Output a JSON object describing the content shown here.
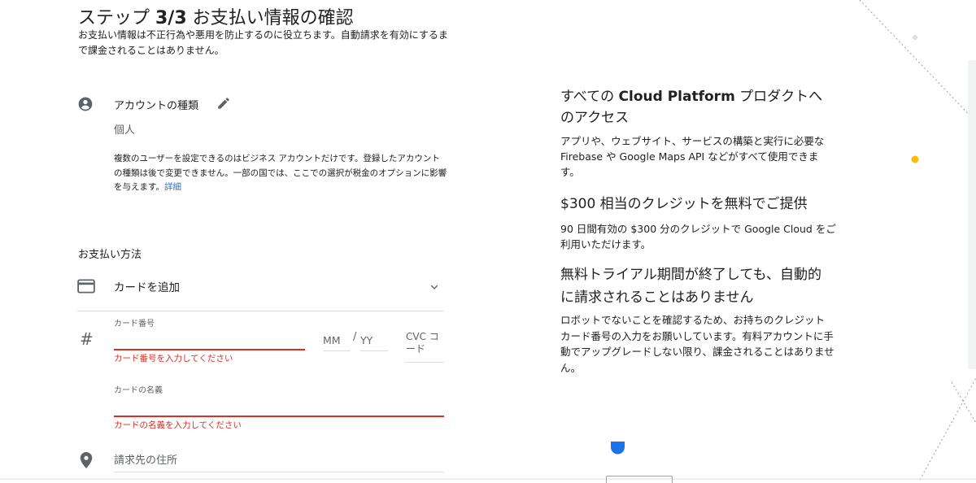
{
  "header": {
    "title_prefix": "ステップ ",
    "title_step": "3/3",
    "title_suffix": " お支払い情報の確認",
    "subtitle": "お支払い情報は不正行為や悪用を防止するのに役立ちます。自動請求を有効にするまで課金されることはありません。"
  },
  "account": {
    "label": "アカウントの種類",
    "value": "個人",
    "note": "複数のユーザーを設定できるのはビジネス アカウントだけです。登録したアカウントの種類は後で変更できません。一部の国では、ここでの選択が税金のオプションに影響を与えます。",
    "link": "詳細",
    "icons": {
      "type": "account-circle-icon",
      "edit": "pencil-icon"
    }
  },
  "payment": {
    "heading": "お支払い方法",
    "method_label": "カードを追加",
    "card_number_label": "カード番号",
    "card_number_value": "",
    "card_number_error": "カード番号を入力してください",
    "month_placeholder": "MM",
    "separator": "/",
    "year_placeholder": "YY",
    "cvc_placeholder": "CVC コード",
    "cardholder_label": "カードの名義",
    "cardholder_value": "",
    "cardholder_error": "カードの名義を入力してください",
    "address_placeholder": "請求先の住所",
    "icons": {
      "card": "credit-card-icon",
      "expand": "chevron-down-icon",
      "number": "hash-icon",
      "address": "location-pin-icon"
    }
  },
  "sidebar": {
    "h1_prefix": "すべての ",
    "h1_bold": "Cloud Platform",
    "h1_suffix": " プロダクトへのアクセス",
    "p1": "アプリや、ウェブサイト、サービスの構築と実行に必要な Firebase や Google Maps API などがすべて使用できます。",
    "h2": "$300 相当のクレジットを無料でご提供",
    "p2": "90 日間有効の $300 分のクレジットで Google Cloud をご利用いただけます。",
    "h3": "無料トライアル期間が終了しても、自動的に請求されることはありません",
    "p3": "ロボットでないことを確認するため、お持ちのクレジット カード番号の入力をお願いしています。有料アカウントに手動でアップグレードしない限り、課金されることはありません。"
  },
  "colors": {
    "error": "#d93025",
    "link": "#1a73e8",
    "text_primary": "#202124",
    "text_secondary": "#5f6368",
    "decor_blue": "#1a73e8",
    "decor_yellow": "#fbbc04"
  }
}
